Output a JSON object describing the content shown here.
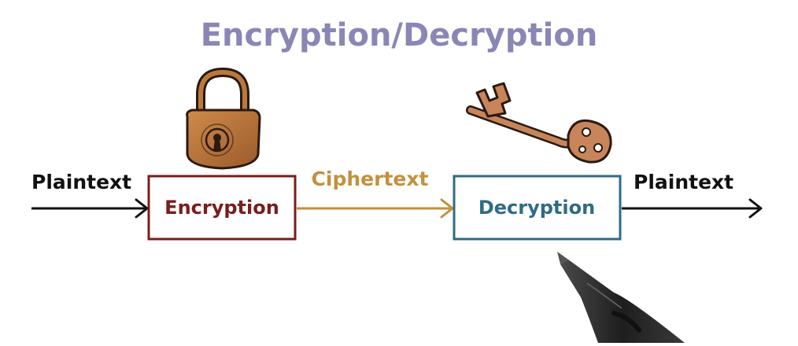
{
  "title": "Encryption/Decryption",
  "nodes": {
    "input_label": "Plaintext",
    "encryption_label": "Encryption",
    "ciphertext_label": "Ciphertext",
    "decryption_label": "Decryption",
    "output_label": "Plaintext"
  },
  "colors": {
    "title": "#8a86b5",
    "encryption": "#7a1d1d",
    "ciphertext": "#c2913f",
    "decryption": "#2f6b86",
    "ink": "#111111",
    "lock_body": "#b8733a",
    "key_body": "#c8845a"
  },
  "icons": {
    "lock": "padlock-icon",
    "key": "key-icon",
    "pen": "stylus-pen"
  }
}
